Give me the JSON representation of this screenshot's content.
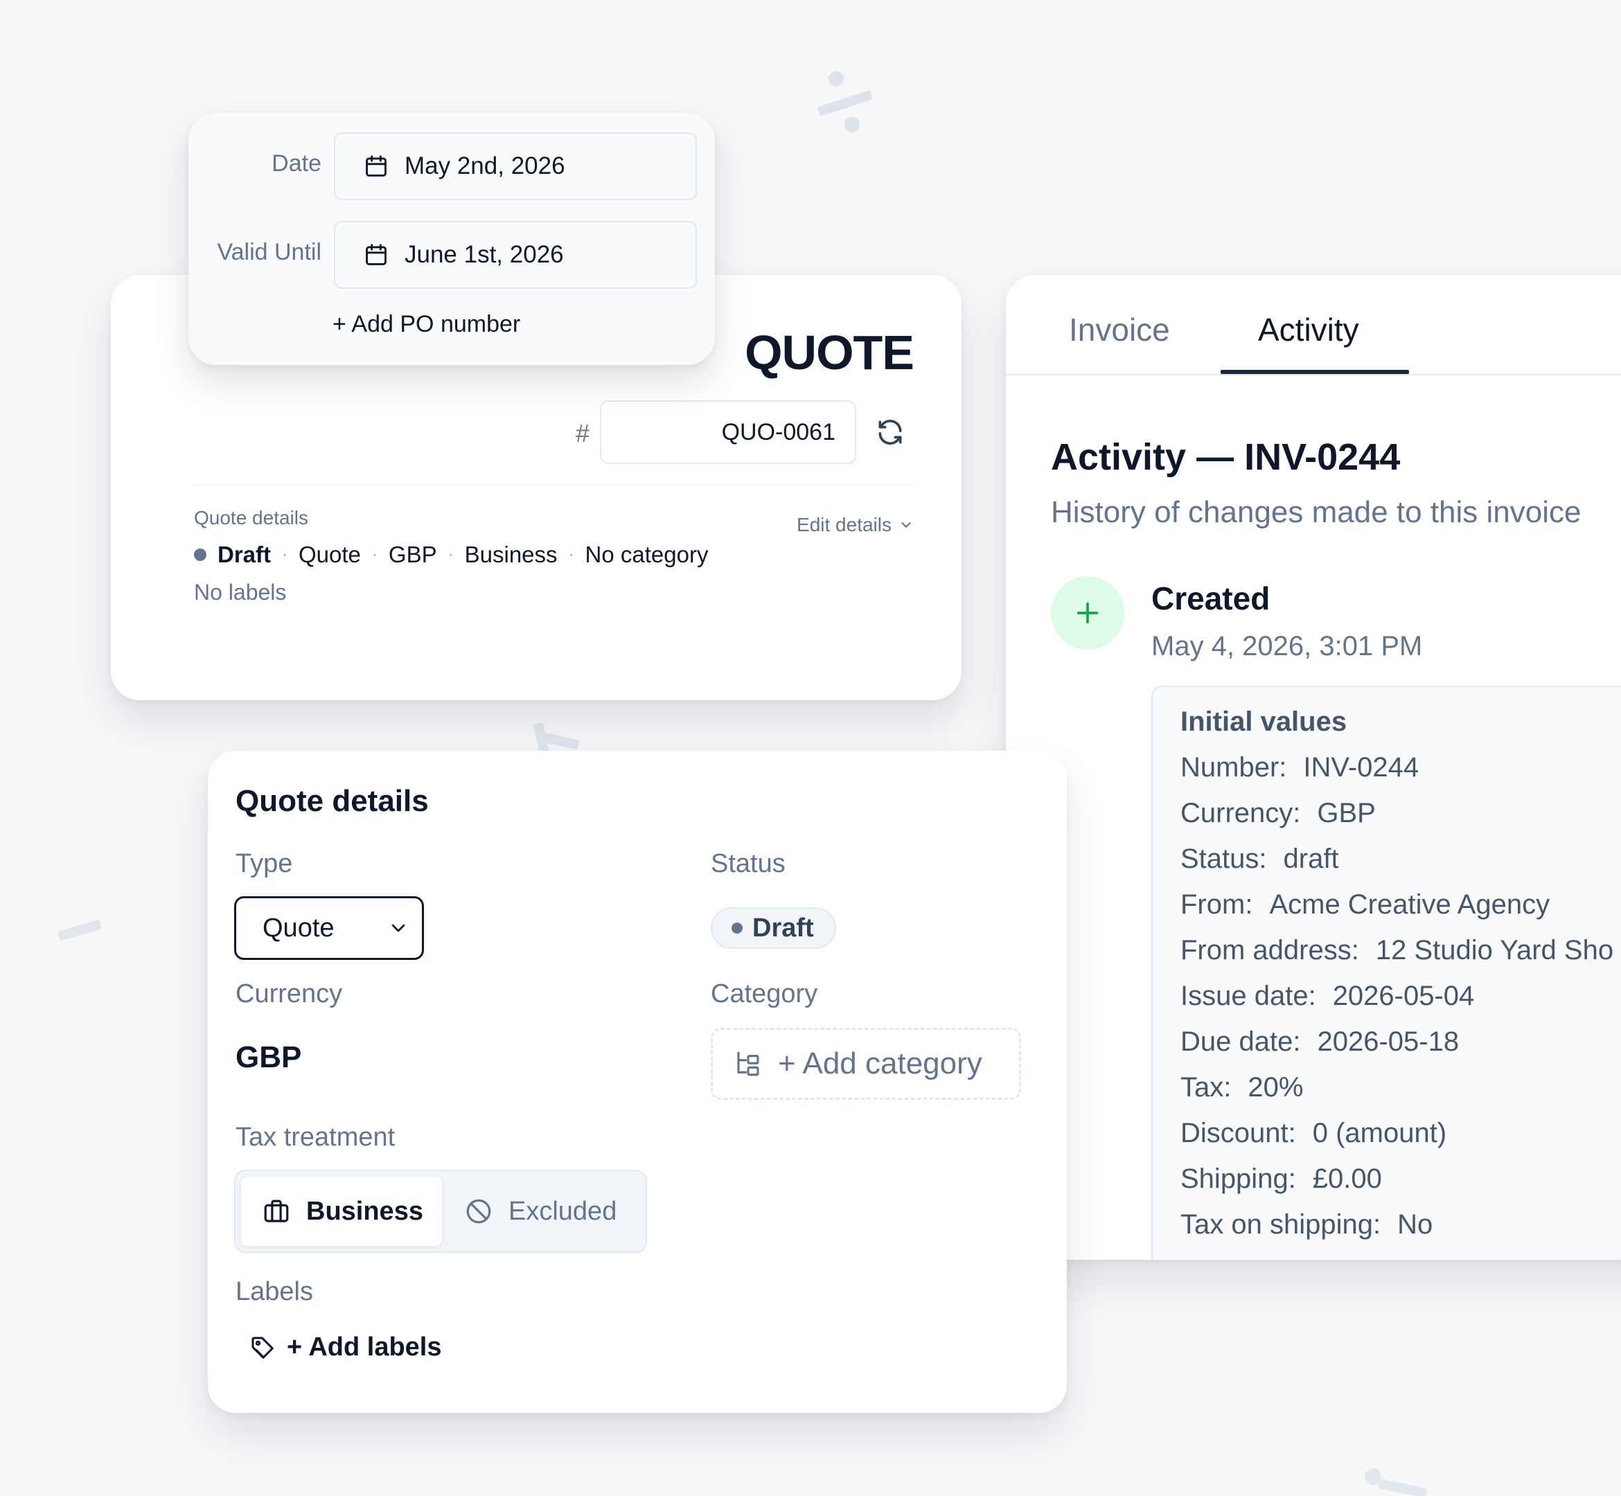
{
  "colors": {
    "background": "#f6f7f9",
    "text_primary": "#0f172a",
    "text_muted": "#64748b",
    "created_icon_bg": "#dcfce7",
    "created_icon_fg": "#16a34a",
    "tab_active_underline": "#1e293b"
  },
  "date_popup": {
    "date_label": "Date",
    "date_value": "May 2nd, 2026",
    "valid_until_label": "Valid Until",
    "valid_until_value": "June 1st, 2026",
    "add_po_label": "+ Add PO number",
    "icons": [
      "calendar-icon"
    ]
  },
  "quote_header": {
    "title": "QUOTE",
    "number_prefix": "#",
    "number": "QUO-0061",
    "details_label": "Quote details",
    "edit_details_label": "Edit details",
    "summary": {
      "status": "Draft",
      "type": "Quote",
      "currency": "GBP",
      "tax_treatment": "Business",
      "category": "No category",
      "separator": "·"
    },
    "labels_text": "No labels",
    "icons": [
      "refresh-icon",
      "chevron-down-icon"
    ]
  },
  "activity_panel": {
    "tabs": [
      {
        "label": "Invoice",
        "active": false
      },
      {
        "label": "Activity",
        "active": true
      }
    ],
    "title": "Activity — INV-0244",
    "subtitle": "History of changes made to this invoice",
    "event": {
      "title": "Created",
      "timestamp": "May 4, 2026, 3:01 PM",
      "icon": "plus-icon",
      "values_heading": "Initial values",
      "values": [
        {
          "key": "Number:",
          "value": "INV-0244"
        },
        {
          "key": "Currency:",
          "value": "GBP"
        },
        {
          "key": "Status:",
          "value": "draft"
        },
        {
          "key": "From:",
          "value": "Acme Creative Agency"
        },
        {
          "key": "From address:",
          "value": "12 Studio Yard Sho"
        },
        {
          "key": "Issue date:",
          "value": "2026-05-04"
        },
        {
          "key": "Due date:",
          "value": "2026-05-18"
        },
        {
          "key": "Tax:",
          "value": "20%"
        },
        {
          "key": "Discount:",
          "value": "0 (amount)"
        },
        {
          "key": "Shipping:",
          "value": "£0.00"
        },
        {
          "key": "Tax on shipping:",
          "value": "No"
        }
      ]
    }
  },
  "details_panel": {
    "title": "Quote details",
    "type_label": "Type",
    "type_value": "Quote",
    "status_label": "Status",
    "status_value": "Draft",
    "currency_label": "Currency",
    "currency_value": "GBP",
    "category_label": "Category",
    "add_category_label": "+ Add category",
    "tax_label": "Tax treatment",
    "tax_options": [
      {
        "label": "Business",
        "selected": true,
        "icon": "briefcase-icon"
      },
      {
        "label": "Excluded",
        "selected": false,
        "icon": "ban-icon"
      }
    ],
    "labels_label": "Labels",
    "add_labels_label": "+ Add labels",
    "icons": [
      "category-icon",
      "tag-icon",
      "chevron-down-icon"
    ]
  }
}
